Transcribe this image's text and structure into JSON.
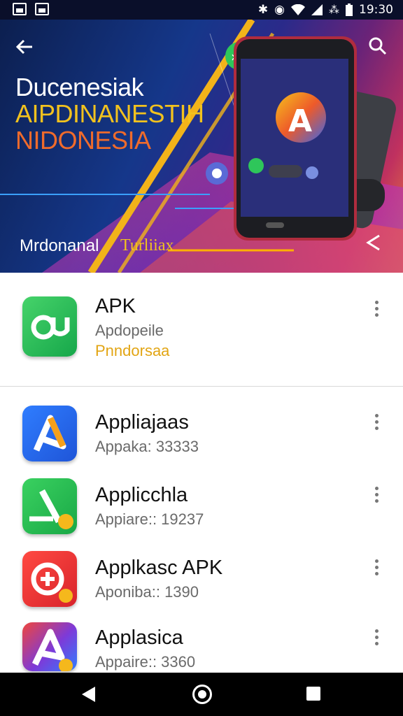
{
  "status_bar": {
    "time": "19:30"
  },
  "hero": {
    "title_lines": [
      "Ducenesiak",
      "AIPDINANESTIH",
      "NIDONESIA"
    ],
    "sub_left": "Mrdonanal",
    "sub_right": "Turliiax",
    "colors": {
      "title_white": "#ffffff",
      "title_yellow": "#f2c21e",
      "title_orange": "#ef6b2c"
    }
  },
  "featured": {
    "title": "APK",
    "subtitle": "Apdopeile",
    "extra": "Pnndorsaa",
    "icon": "green-apk-logo-icon"
  },
  "apps": [
    {
      "title": "Appliajaas",
      "subtitle": "Appaka: 33333",
      "icon": "blue-a-app-icon"
    },
    {
      "title": "Applicchla",
      "subtitle": "Appiare:: 19237",
      "icon": "green-app-icon"
    },
    {
      "title": "Applkasc APK",
      "subtitle": "Aponiba:: 1390",
      "icon": "red-app-icon"
    },
    {
      "title": "Applasica",
      "subtitle": "Appaire:: 3360",
      "icon": "multicolor-a-app-icon"
    }
  ]
}
